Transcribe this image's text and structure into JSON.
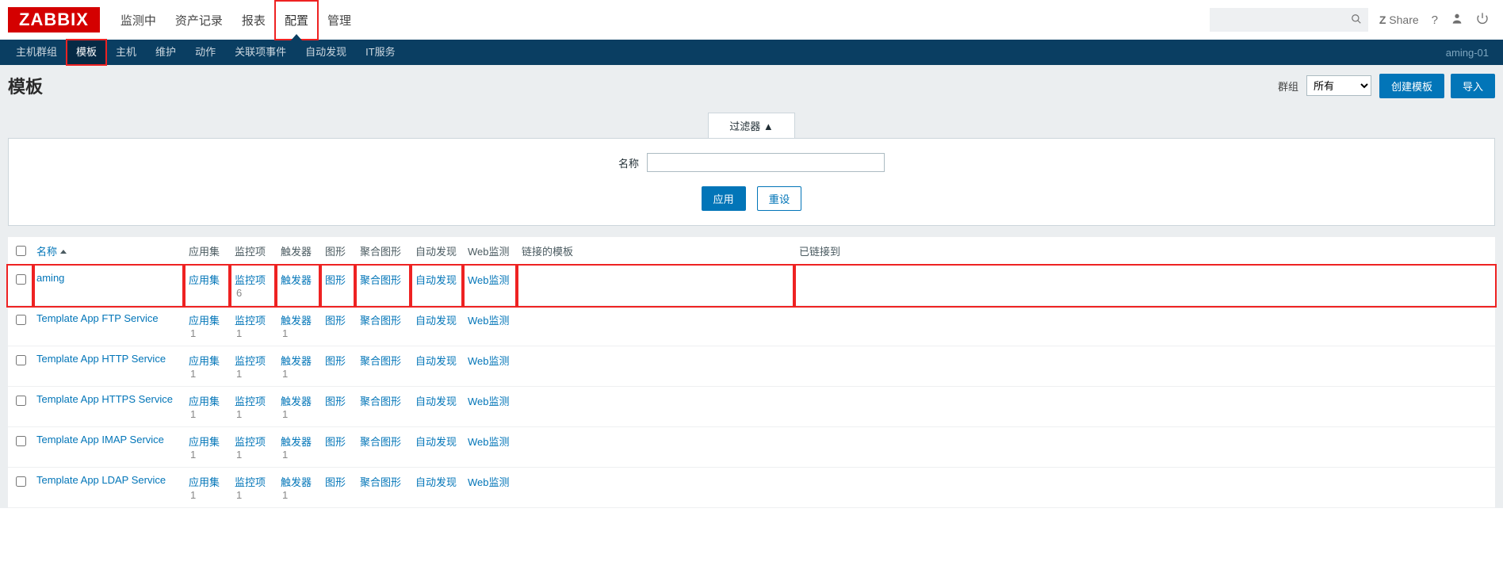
{
  "brand": "ZABBIX",
  "topnav": {
    "items": [
      {
        "label": "监测中"
      },
      {
        "label": "资产记录"
      },
      {
        "label": "报表"
      },
      {
        "label": "配置",
        "active": true,
        "highlight": true
      },
      {
        "label": "管理"
      }
    ],
    "search_placeholder": "",
    "share": "Share"
  },
  "subnav": {
    "items": [
      {
        "label": "主机群组"
      },
      {
        "label": "模板",
        "active": true,
        "highlight": true
      },
      {
        "label": "主机"
      },
      {
        "label": "维护"
      },
      {
        "label": "动作"
      },
      {
        "label": "关联项事件"
      },
      {
        "label": "自动发现"
      },
      {
        "label": "IT服务"
      }
    ],
    "user": "aming-01"
  },
  "page": {
    "title": "模板",
    "group_label": "群组",
    "group_value": "所有",
    "create_btn": "创建模板",
    "import_btn": "导入"
  },
  "filter": {
    "tab": "过滤器 ▲",
    "name_label": "名称",
    "name_value": "",
    "apply": "应用",
    "reset": "重设"
  },
  "columns": {
    "name": "名称",
    "apps": "应用集",
    "items": "监控项",
    "triggers": "触发器",
    "graphs": "图形",
    "screens": "聚合图形",
    "discovery": "自动发现",
    "web": "Web监测",
    "linked": "链接的模板",
    "linkedto": "已链接到"
  },
  "links": {
    "apps": "应用集",
    "items": "监控项",
    "triggers": "触发器",
    "graphs": "图形",
    "screens": "聚合图形",
    "discovery": "自动发现",
    "web": "Web监测"
  },
  "rows": [
    {
      "name": "aming",
      "apps": "",
      "items": "6",
      "triggers": "",
      "graphs": "",
      "screens": "",
      "discovery": "",
      "web": "",
      "highlight": true
    },
    {
      "name": "Template App FTP Service",
      "apps": "1",
      "items": "1",
      "triggers": "1"
    },
    {
      "name": "Template App HTTP Service",
      "apps": "1",
      "items": "1",
      "triggers": "1"
    },
    {
      "name": "Template App HTTPS Service",
      "apps": "1",
      "items": "1",
      "triggers": "1"
    },
    {
      "name": "Template App IMAP Service",
      "apps": "1",
      "items": "1",
      "triggers": "1"
    },
    {
      "name": "Template App LDAP Service",
      "apps": "1",
      "items": "1",
      "triggers": "1"
    }
  ]
}
